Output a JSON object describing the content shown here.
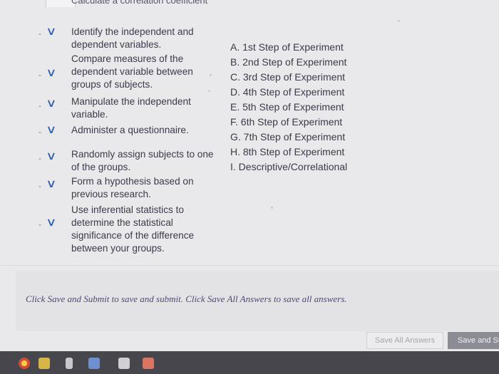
{
  "header": {
    "cut_off_title": "Calculate a correlation coefficient"
  },
  "matching": {
    "prompts": [
      "Identify the independent and dependent variables.",
      "Compare measures of the dependent variable between groups of subjects.",
      "Manipulate the independent variable.",
      "Administer a questionnaire.",
      "Randomly assign subjects to one of the groups.",
      "Form a hypothesis based on previous research.",
      "Use inferential statistics to determine the statistical significance of the difference between your groups."
    ],
    "answer_options": [
      "A. 1st Step of Experiment",
      "B. 2nd Step of Experiment",
      "C. 3rd Step of Experiment",
      "D. 4th Step of Experiment",
      "E. 5th Step of Experiment",
      "F. 6th Step of Experiment",
      "G. 7th Step of Experiment",
      "H. 8th Step of Experiment",
      "I. Descriptive/Correlational"
    ],
    "select_value": "-"
  },
  "footer": {
    "instruction": "Click Save and Submit to save and submit. Click Save All Answers to save all answers.",
    "save_all_label": "Save All Answers",
    "save_submit_label": "Save and Submit"
  },
  "taskbar": {
    "icons": [
      "chrome-icon",
      "store-icon",
      "file-icon",
      "word-icon",
      "mail-icon",
      "t-app-icon"
    ]
  },
  "colors": {
    "accent": "#2c5fa8",
    "taskbar": "#46464c",
    "button_dark": "#8c8c94"
  }
}
